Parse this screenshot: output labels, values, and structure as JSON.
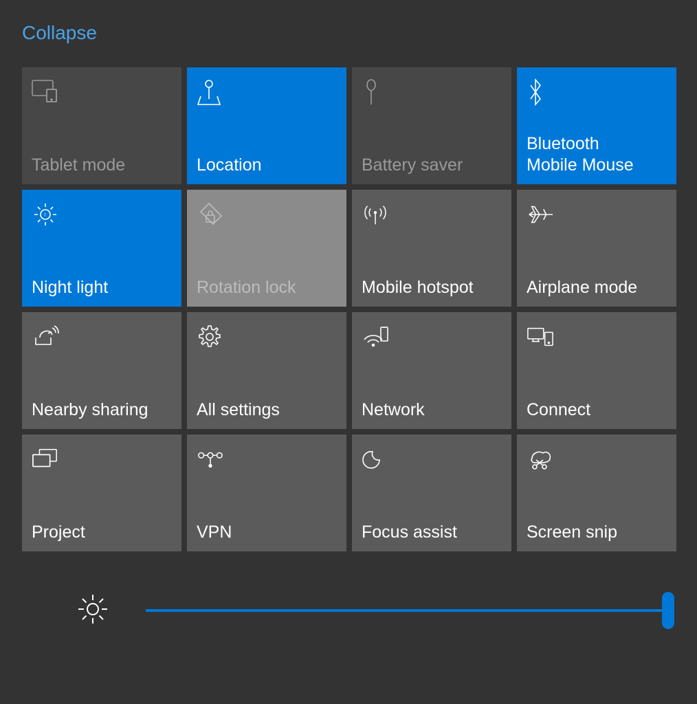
{
  "collapse_label": "Collapse",
  "tiles": [
    {
      "key": "tablet-mode",
      "label": "Tablet mode",
      "state": "disabled"
    },
    {
      "key": "location",
      "label": "Location",
      "state": "active"
    },
    {
      "key": "battery-saver",
      "label": "Battery saver",
      "state": "disabled"
    },
    {
      "key": "bluetooth",
      "label": "Bluetooth\nMobile Mouse",
      "state": "active"
    },
    {
      "key": "night-light",
      "label": "Night light",
      "state": "active"
    },
    {
      "key": "rotation-lock",
      "label": "Rotation lock",
      "state": "disabled-light"
    },
    {
      "key": "mobile-hotspot",
      "label": "Mobile hotspot",
      "state": "normal"
    },
    {
      "key": "airplane-mode",
      "label": "Airplane mode",
      "state": "normal"
    },
    {
      "key": "nearby-sharing",
      "label": "Nearby sharing",
      "state": "normal"
    },
    {
      "key": "all-settings",
      "label": "All settings",
      "state": "normal"
    },
    {
      "key": "network",
      "label": "Network",
      "state": "normal"
    },
    {
      "key": "connect",
      "label": "Connect",
      "state": "normal"
    },
    {
      "key": "project",
      "label": "Project",
      "state": "normal"
    },
    {
      "key": "vpn",
      "label": "VPN",
      "state": "normal"
    },
    {
      "key": "focus-assist",
      "label": "Focus assist",
      "state": "normal"
    },
    {
      "key": "screen-snip",
      "label": "Screen snip",
      "state": "normal"
    }
  ],
  "brightness": {
    "value_percent": 100
  },
  "colors": {
    "accent": "#0078d7",
    "tile_normal": "#5b5b5b",
    "tile_disabled": "#474747",
    "tile_disabled_light": "#8b8b8b",
    "background": "#333333"
  }
}
